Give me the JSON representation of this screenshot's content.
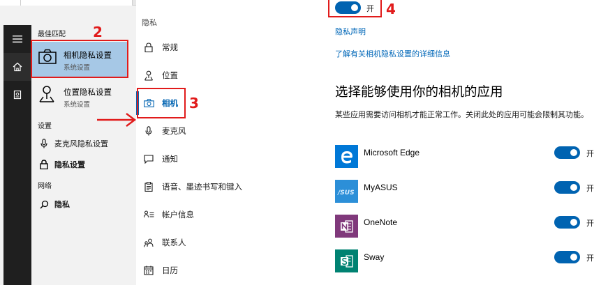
{
  "start": {
    "groups": {
      "best": "最佳匹配",
      "settings": "设置",
      "network": "网络"
    },
    "best_match": {
      "title": "相机隐私设置",
      "subtitle": "系统设置"
    },
    "secondary_match": {
      "title": "位置隐私设置",
      "subtitle": "系统设置"
    },
    "settings_items": [
      {
        "label": "麦克风隐私设置",
        "icon": "microphone-icon"
      },
      {
        "label": "隐私设置",
        "icon": "lock-icon"
      }
    ],
    "network_items": [
      {
        "label": "隐私",
        "icon": "search-icon"
      }
    ],
    "rail_icons": [
      "hamburger-menu-icon",
      "home-icon",
      "notebook-icon"
    ]
  },
  "nav": {
    "title": "隐私",
    "items": [
      {
        "label": "常规",
        "icon": "lock-icon"
      },
      {
        "label": "位置",
        "icon": "location-icon"
      },
      {
        "label": "相机",
        "icon": "camera-icon",
        "active": true
      },
      {
        "label": "麦克风",
        "icon": "microphone-icon"
      },
      {
        "label": "通知",
        "icon": "notification-icon"
      },
      {
        "label": "语音、墨迹书写和键入",
        "icon": "clipboard-icon"
      },
      {
        "label": "帐户信息",
        "icon": "account-info-icon"
      },
      {
        "label": "联系人",
        "icon": "contacts-icon"
      },
      {
        "label": "日历",
        "icon": "calendar-icon"
      }
    ]
  },
  "content": {
    "master_toggle_state": "开",
    "privacy_statement_link": "隐私声明",
    "learn_more_link": "了解有关相机隐私设置的详细信息",
    "section_title": "选择能够使用你的相机的应用",
    "section_desc": "某些应用需要访问相机才能正常工作。关闭此处的应用可能会限制其功能。",
    "apps": [
      {
        "name": "Microsoft Edge",
        "state": "开",
        "tile_color": "#0078d7",
        "icon": "edge-icon"
      },
      {
        "name": "MyASUS",
        "state": "开",
        "tile_color": "#2c8fd8",
        "icon": "asus-icon"
      },
      {
        "name": "OneNote",
        "state": "开",
        "tile_color": "#80397b",
        "icon": "onenote-icon"
      },
      {
        "name": "Sway",
        "state": "开",
        "tile_color": "#008272",
        "icon": "sway-icon"
      }
    ]
  },
  "annotations": {
    "step2": "2",
    "step3": "3",
    "step4": "4"
  },
  "colors": {
    "accent": "#0063b1",
    "highlight": "#a6c8e6",
    "annotation": "#e11b1b"
  }
}
